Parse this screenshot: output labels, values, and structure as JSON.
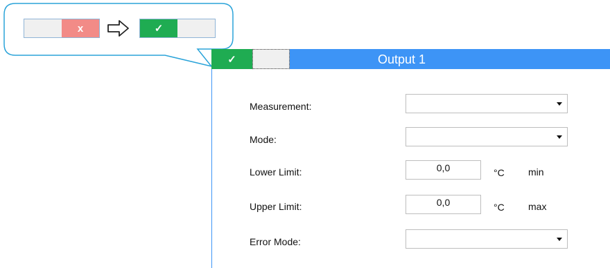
{
  "callout": {
    "before_toggle": {
      "off_label": "x"
    },
    "after_toggle": {
      "on_label": "✓"
    }
  },
  "panel": {
    "toggle_on_label": "✓",
    "title": "Output 1"
  },
  "fields": {
    "measurement": {
      "label": "Measurement:",
      "value": ""
    },
    "mode": {
      "label": "Mode:",
      "value": ""
    },
    "lower_limit": {
      "label": "Lower Limit:",
      "value": "0,0",
      "unit": "°C",
      "qualifier": "min"
    },
    "upper_limit": {
      "label": "Upper Limit:",
      "value": "0,0",
      "unit": "°C",
      "qualifier": "max"
    },
    "error_mode": {
      "label": "Error Mode:",
      "value": ""
    }
  },
  "colors": {
    "header_blue": "#3d94f6",
    "toggle_on": "#1fac52",
    "toggle_off": "#f28b87",
    "callout_border": "#2aa3d9"
  }
}
